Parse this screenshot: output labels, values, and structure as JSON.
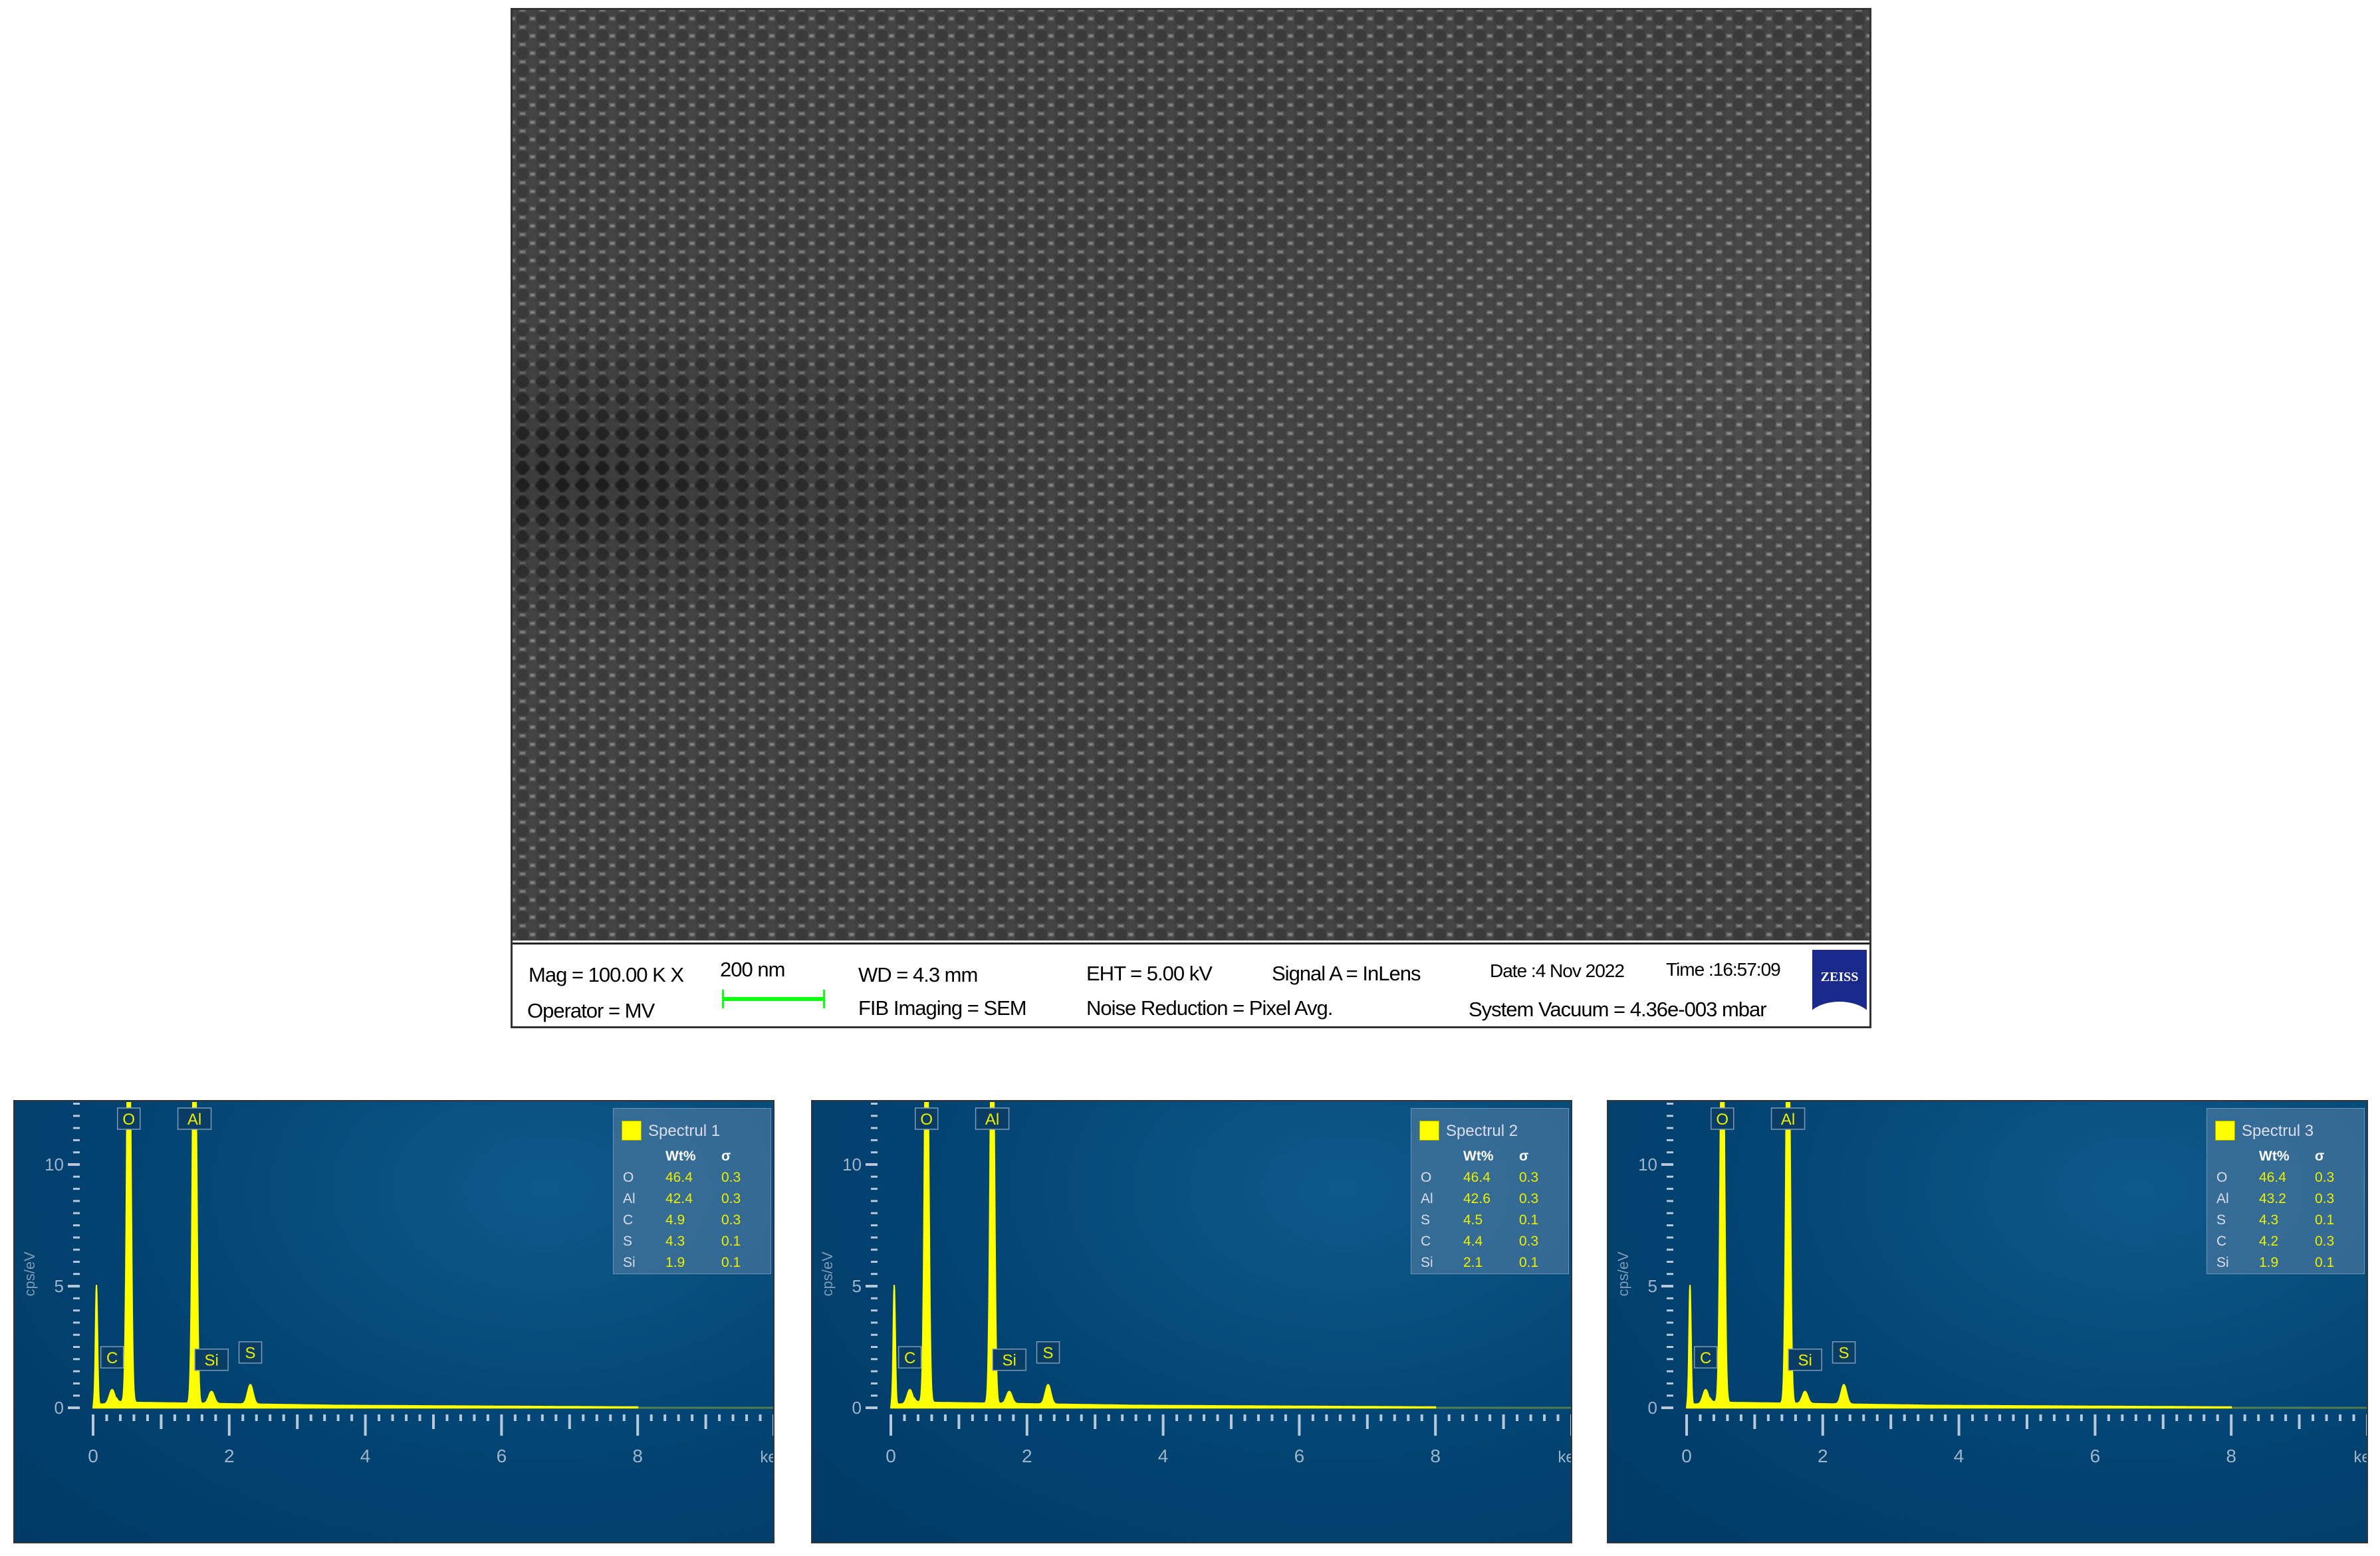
{
  "sem": {
    "mag": "Mag = 100.00 K X",
    "scale": "200 nm",
    "wd": "WD = 4.3 mm",
    "eht": "EHT = 5.00 kV",
    "signal": "Signal A = InLens",
    "date": "Date :4 Nov 2022",
    "time": "Time :16:57:09",
    "operator": "Operator = MV",
    "fib": "FIB Imaging = SEM",
    "noise": "Noise Reduction = Pixel Avg.",
    "vacuum": "System Vacuum = 4.36e-003 mbar",
    "logo": "ZEISS",
    "scalebar_color": "#22ee22"
  },
  "chart_data": [
    {
      "type": "line",
      "title": "Spectrul 1",
      "xlabel": "keV",
      "ylabel": "cps/eV",
      "xlim": [
        0,
        10
      ],
      "ylim": [
        0,
        12.5
      ],
      "xticks": [
        "0",
        "2",
        "4",
        "6",
        "8"
      ],
      "yticks": [
        "0",
        "5",
        "10"
      ],
      "color": "#ffff00",
      "peaks": [
        {
          "el": "",
          "e": 0.05,
          "h": 4.9
        },
        {
          "el": "C",
          "e": 0.28,
          "h": 0.6
        },
        {
          "el": "O",
          "e": 0.525,
          "h": 20
        },
        {
          "el": "Al",
          "e": 1.49,
          "h": 20
        },
        {
          "el": "Si",
          "e": 1.74,
          "h": 0.5
        },
        {
          "el": "S",
          "e": 2.31,
          "h": 0.8
        }
      ],
      "legend": {
        "header": [
          "Wt%",
          "σ"
        ],
        "rows": [
          [
            "O",
            "46.4",
            "0.3"
          ],
          [
            "Al",
            "42.4",
            "0.3"
          ],
          [
            "C",
            "4.9",
            "0.3"
          ],
          [
            "S",
            "4.3",
            "0.1"
          ],
          [
            "Si",
            "1.9",
            "0.1"
          ]
        ]
      }
    },
    {
      "type": "line",
      "title": "Spectrul 2",
      "xlabel": "keV",
      "ylabel": "cps/eV",
      "xlim": [
        0,
        10
      ],
      "ylim": [
        0,
        12.5
      ],
      "xticks": [
        "0",
        "2",
        "4",
        "6",
        "8"
      ],
      "yticks": [
        "0",
        "5",
        "10"
      ],
      "color": "#ffff00",
      "peaks": [
        {
          "el": "",
          "e": 0.05,
          "h": 4.9
        },
        {
          "el": "C",
          "e": 0.28,
          "h": 0.6
        },
        {
          "el": "O",
          "e": 0.525,
          "h": 20
        },
        {
          "el": "Al",
          "e": 1.49,
          "h": 20
        },
        {
          "el": "Si",
          "e": 1.74,
          "h": 0.5
        },
        {
          "el": "S",
          "e": 2.31,
          "h": 0.8
        }
      ],
      "legend": {
        "header": [
          "Wt%",
          "σ"
        ],
        "rows": [
          [
            "O",
            "46.4",
            "0.3"
          ],
          [
            "Al",
            "42.6",
            "0.3"
          ],
          [
            "S",
            "4.5",
            "0.1"
          ],
          [
            "C",
            "4.4",
            "0.3"
          ],
          [
            "Si",
            "2.1",
            "0.1"
          ]
        ]
      }
    },
    {
      "type": "line",
      "title": "Spectrul 3",
      "xlabel": "keV",
      "ylabel": "cps/eV",
      "xlim": [
        0,
        10
      ],
      "ylim": [
        0,
        12.5
      ],
      "xticks": [
        "0",
        "2",
        "4",
        "6",
        "8"
      ],
      "yticks": [
        "0",
        "5",
        "10"
      ],
      "color": "#ffff00",
      "peaks": [
        {
          "el": "",
          "e": 0.05,
          "h": 4.9
        },
        {
          "el": "C",
          "e": 0.28,
          "h": 0.6
        },
        {
          "el": "O",
          "e": 0.525,
          "h": 20
        },
        {
          "el": "Al",
          "e": 1.49,
          "h": 20
        },
        {
          "el": "Si",
          "e": 1.74,
          "h": 0.5
        },
        {
          "el": "S",
          "e": 2.31,
          "h": 0.8
        }
      ],
      "legend": {
        "header": [
          "Wt%",
          "σ"
        ],
        "rows": [
          [
            "O",
            "46.4",
            "0.3"
          ],
          [
            "Al",
            "43.2",
            "0.3"
          ],
          [
            "S",
            "4.3",
            "0.1"
          ],
          [
            "C",
            "4.2",
            "0.3"
          ],
          [
            "Si",
            "1.9",
            "0.1"
          ]
        ]
      }
    }
  ]
}
